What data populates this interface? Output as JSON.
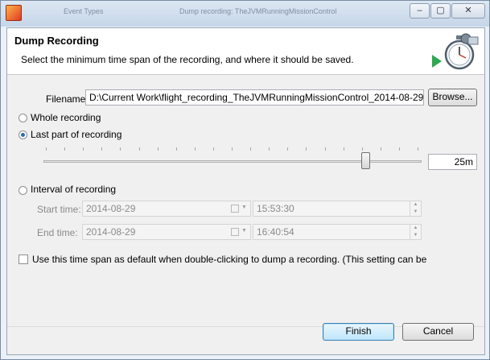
{
  "window": {
    "minimize_glyph": "–",
    "maximize_glyph": "▢",
    "close_glyph": "✕"
  },
  "background_titles": [
    "Event Types",
    "Dump recording: TheJVMRunningMissionControl"
  ],
  "dialog": {
    "title": "Dump Recording",
    "description": "Select the minimum time span of the recording, and where it should be saved."
  },
  "filename": {
    "label": "Filename:",
    "value": "D:\\Current Work\\flight_recording_TheJVMRunningMissionControl_2014-08-29.",
    "browse_label": "Browse..."
  },
  "options": {
    "whole_recording": "Whole recording",
    "last_part": "Last part of recording",
    "selected": "last_part",
    "interval": "Interval of recording"
  },
  "slider": {
    "value_label": "25m",
    "position_fraction": 0.86
  },
  "interval": {
    "start_label": "Start time:",
    "start_date": "2014-08-29",
    "start_time": "15:53:30",
    "end_label": "End time:",
    "end_date": "2014-08-29",
    "end_time": "16:40:54"
  },
  "default_checkbox": {
    "label": "Use this time span as default when double-clicking to dump a recording. (This setting can be",
    "checked": false
  },
  "buttons": {
    "finish": "Finish",
    "cancel": "Cancel"
  },
  "icons": {
    "app": "flight-recorder-app-icon",
    "header": "stopwatch-record-icon"
  }
}
